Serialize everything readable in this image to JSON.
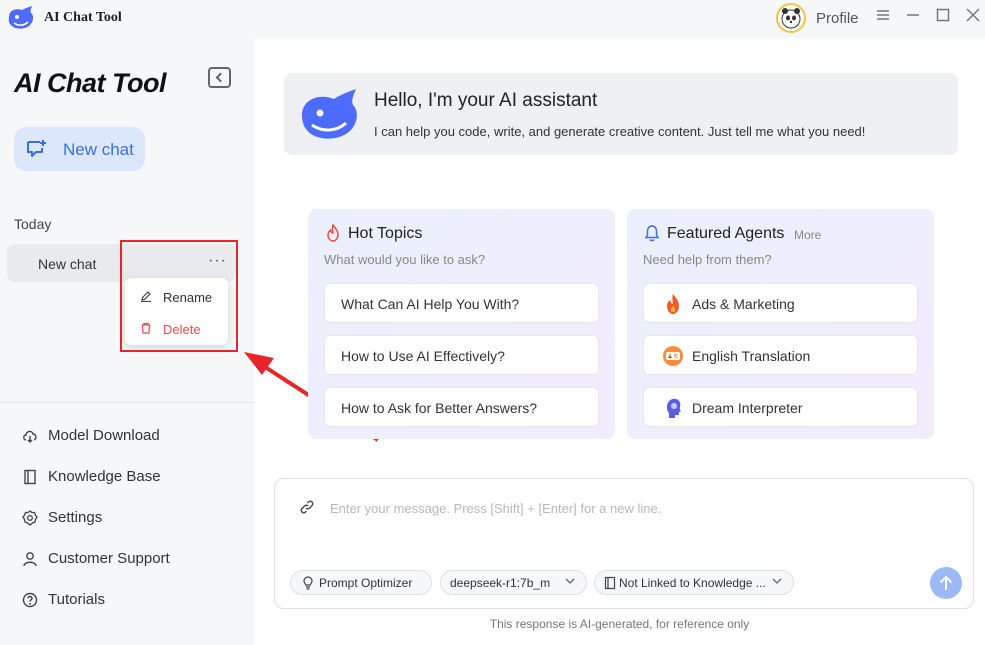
{
  "titlebar": {
    "app_title": "AI Chat Tool",
    "profile_label": "Profile"
  },
  "sidebar": {
    "brand": "AI Chat Tool",
    "new_chat_label": "New chat",
    "section_today": "Today",
    "chat_items": [
      {
        "label": "New chat"
      }
    ],
    "context_menu": {
      "rename": "Rename",
      "delete": "Delete"
    },
    "nav": [
      {
        "label": "Model Download",
        "icon": "cloud-download-icon"
      },
      {
        "label": "Knowledge Base",
        "icon": "book-icon"
      },
      {
        "label": "Settings",
        "icon": "gear-icon"
      },
      {
        "label": "Customer Support",
        "icon": "user-icon"
      },
      {
        "label": "Tutorials",
        "icon": "help-icon"
      }
    ]
  },
  "hero": {
    "title": "Hello, I'm your AI assistant",
    "subtitle": "I can help you code, write, and generate creative content. Just tell me what you need!"
  },
  "hot_topics": {
    "title": "Hot Topics",
    "subtitle": "What would you like to ask?",
    "items": [
      "What Can AI Help You With?",
      "How to Use AI Effectively?",
      "How to Ask for Better Answers?"
    ]
  },
  "featured_agents": {
    "title": "Featured Agents",
    "more": "More",
    "subtitle": "Need help from them?",
    "items": [
      {
        "label": "Ads & Marketing",
        "icon": "flame-icon"
      },
      {
        "label": "English Translation",
        "icon": "translate-icon"
      },
      {
        "label": "Dream Interpreter",
        "icon": "head-icon"
      }
    ]
  },
  "composer": {
    "placeholder": "Enter your message. Press [Shift] + [Enter] for a new line.",
    "prompt_optimizer": "Prompt Optimizer",
    "model": "deepseek-r1:7b_m",
    "knowledge": "Not Linked to Knowledge ..."
  },
  "disclaimer": "This response is AI-generated, for reference only",
  "colors": {
    "accent": "#3a6ee8",
    "danger": "#e84a4a",
    "annotation": "#e5262b"
  }
}
